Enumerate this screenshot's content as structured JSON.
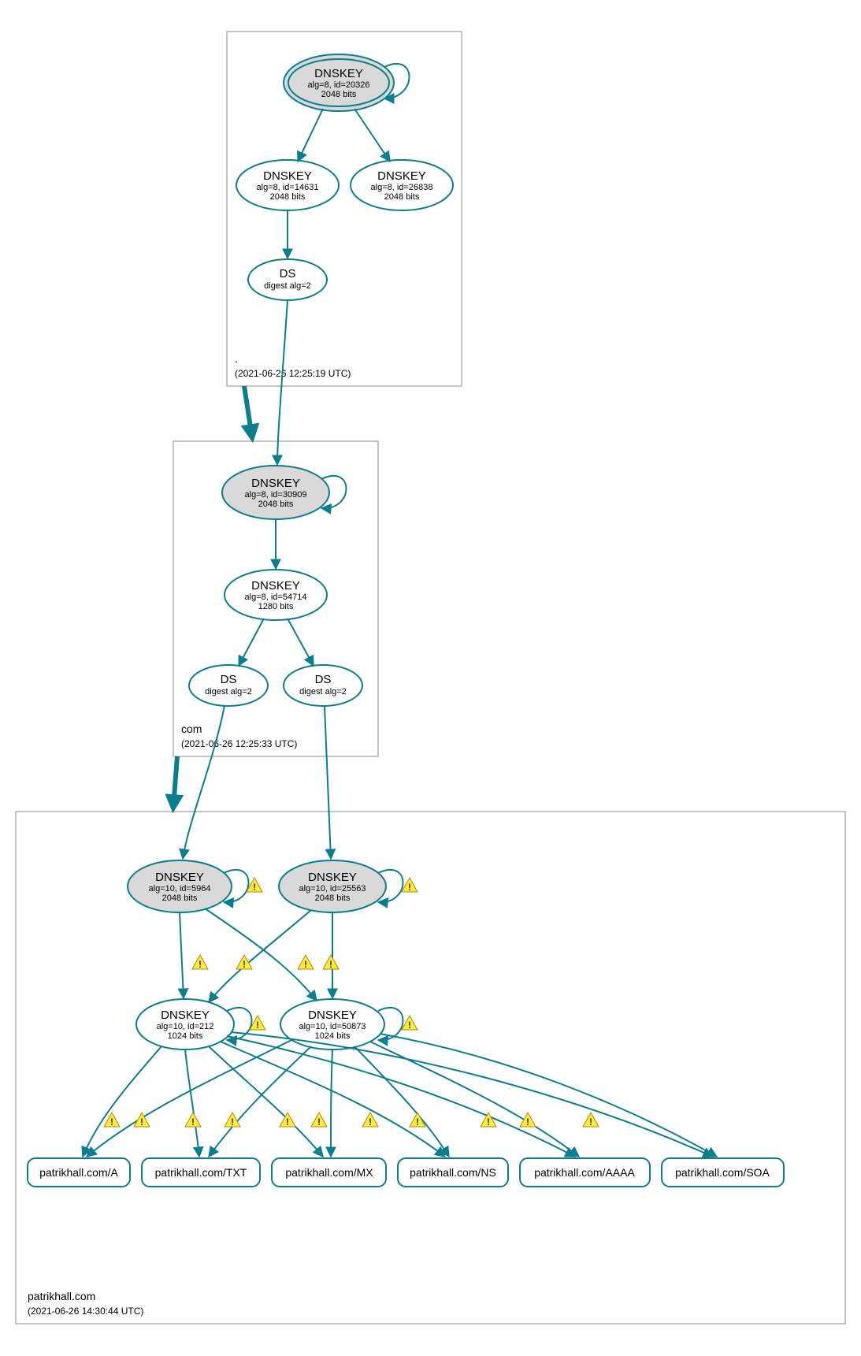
{
  "chart_data": {
    "type": "dnssec-hierarchy",
    "zones": [
      {
        "id": "root",
        "label": ".",
        "timestamp": "(2021-06-26 12:25:19 UTC)"
      },
      {
        "id": "com",
        "label": "com",
        "timestamp": "(2021-06-26 12:25:33 UTC)"
      },
      {
        "id": "patrikhall",
        "label": "patrikhall.com",
        "timestamp": "(2021-06-26 14:30:44 UTC)"
      }
    ],
    "nodes": {
      "root_ksk": {
        "title": "DNSKEY",
        "line2": "alg=8, id=20326",
        "line3": "2048 bits",
        "trust_anchor": true,
        "self_loop": true
      },
      "root_zsk1": {
        "title": "DNSKEY",
        "line2": "alg=8, id=14631",
        "line3": "2048 bits"
      },
      "root_zsk2": {
        "title": "DNSKEY",
        "line2": "alg=8, id=26838",
        "line3": "2048 bits"
      },
      "root_ds": {
        "title": "DS",
        "line2": "digest alg=2"
      },
      "com_ksk": {
        "title": "DNSKEY",
        "line2": "alg=8, id=30909",
        "line3": "2048 bits",
        "self_loop": true
      },
      "com_zsk": {
        "title": "DNSKEY",
        "line2": "alg=8, id=54714",
        "line3": "1280 bits"
      },
      "com_ds1": {
        "title": "DS",
        "line2": "digest alg=2"
      },
      "com_ds2": {
        "title": "DS",
        "line2": "digest alg=2"
      },
      "ph_ksk1": {
        "title": "DNSKEY",
        "line2": "alg=10, id=5964",
        "line3": "2048 bits",
        "self_loop": true,
        "warnings": true
      },
      "ph_ksk2": {
        "title": "DNSKEY",
        "line2": "alg=10, id=25563",
        "line3": "2048 bits",
        "self_loop": true,
        "warnings": true
      },
      "ph_zsk1": {
        "title": "DNSKEY",
        "line2": "alg=10, id=212",
        "line3": "1024 bits",
        "self_loop": true,
        "warnings": true
      },
      "ph_zsk2": {
        "title": "DNSKEY",
        "line2": "alg=10, id=50873",
        "line3": "1024 bits",
        "self_loop": true,
        "warnings": true
      }
    },
    "rrsets": [
      {
        "id": "rr_a",
        "label": "patrikhall.com/A"
      },
      {
        "id": "rr_txt",
        "label": "patrikhall.com/TXT"
      },
      {
        "id": "rr_mx",
        "label": "patrikhall.com/MX"
      },
      {
        "id": "rr_ns",
        "label": "patrikhall.com/NS"
      },
      {
        "id": "rr_aaaa",
        "label": "patrikhall.com/AAAA"
      },
      {
        "id": "rr_soa",
        "label": "patrikhall.com/SOA"
      }
    ],
    "edges": [
      {
        "from": "root_ksk",
        "to": "root_zsk1"
      },
      {
        "from": "root_ksk",
        "to": "root_zsk2"
      },
      {
        "from": "root_zsk1",
        "to": "root_ds"
      },
      {
        "from": "root_ds",
        "to": "com_ksk"
      },
      {
        "from": "com_ksk",
        "to": "com_zsk"
      },
      {
        "from": "com_zsk",
        "to": "com_ds1"
      },
      {
        "from": "com_zsk",
        "to": "com_ds2"
      },
      {
        "from": "com_ds1",
        "to": "ph_ksk1"
      },
      {
        "from": "com_ds2",
        "to": "ph_ksk2"
      },
      {
        "from": "ph_ksk1",
        "to": "ph_zsk1",
        "warn": true
      },
      {
        "from": "ph_ksk1",
        "to": "ph_zsk2",
        "warn": true
      },
      {
        "from": "ph_ksk2",
        "to": "ph_zsk1",
        "warn": true
      },
      {
        "from": "ph_ksk2",
        "to": "ph_zsk2",
        "warn": true
      },
      {
        "from": "ph_zsk1",
        "to": "rr_a",
        "warn": true
      },
      {
        "from": "ph_zsk1",
        "to": "rr_txt",
        "warn": true
      },
      {
        "from": "ph_zsk1",
        "to": "rr_mx",
        "warn": true
      },
      {
        "from": "ph_zsk1",
        "to": "rr_ns",
        "warn": true
      },
      {
        "from": "ph_zsk1",
        "to": "rr_aaaa",
        "warn": true
      },
      {
        "from": "ph_zsk1",
        "to": "rr_soa",
        "warn": true
      },
      {
        "from": "ph_zsk2",
        "to": "rr_a",
        "warn": true
      },
      {
        "from": "ph_zsk2",
        "to": "rr_txt",
        "warn": true
      },
      {
        "from": "ph_zsk2",
        "to": "rr_mx",
        "warn": true
      },
      {
        "from": "ph_zsk2",
        "to": "rr_ns",
        "warn": true
      },
      {
        "from": "ph_zsk2",
        "to": "rr_aaaa",
        "warn": true
      },
      {
        "from": "ph_zsk2",
        "to": "rr_soa",
        "warn": true
      }
    ],
    "zone_delegations": [
      {
        "from": "root",
        "to": "com"
      },
      {
        "from": "com",
        "to": "patrikhall"
      }
    ]
  }
}
